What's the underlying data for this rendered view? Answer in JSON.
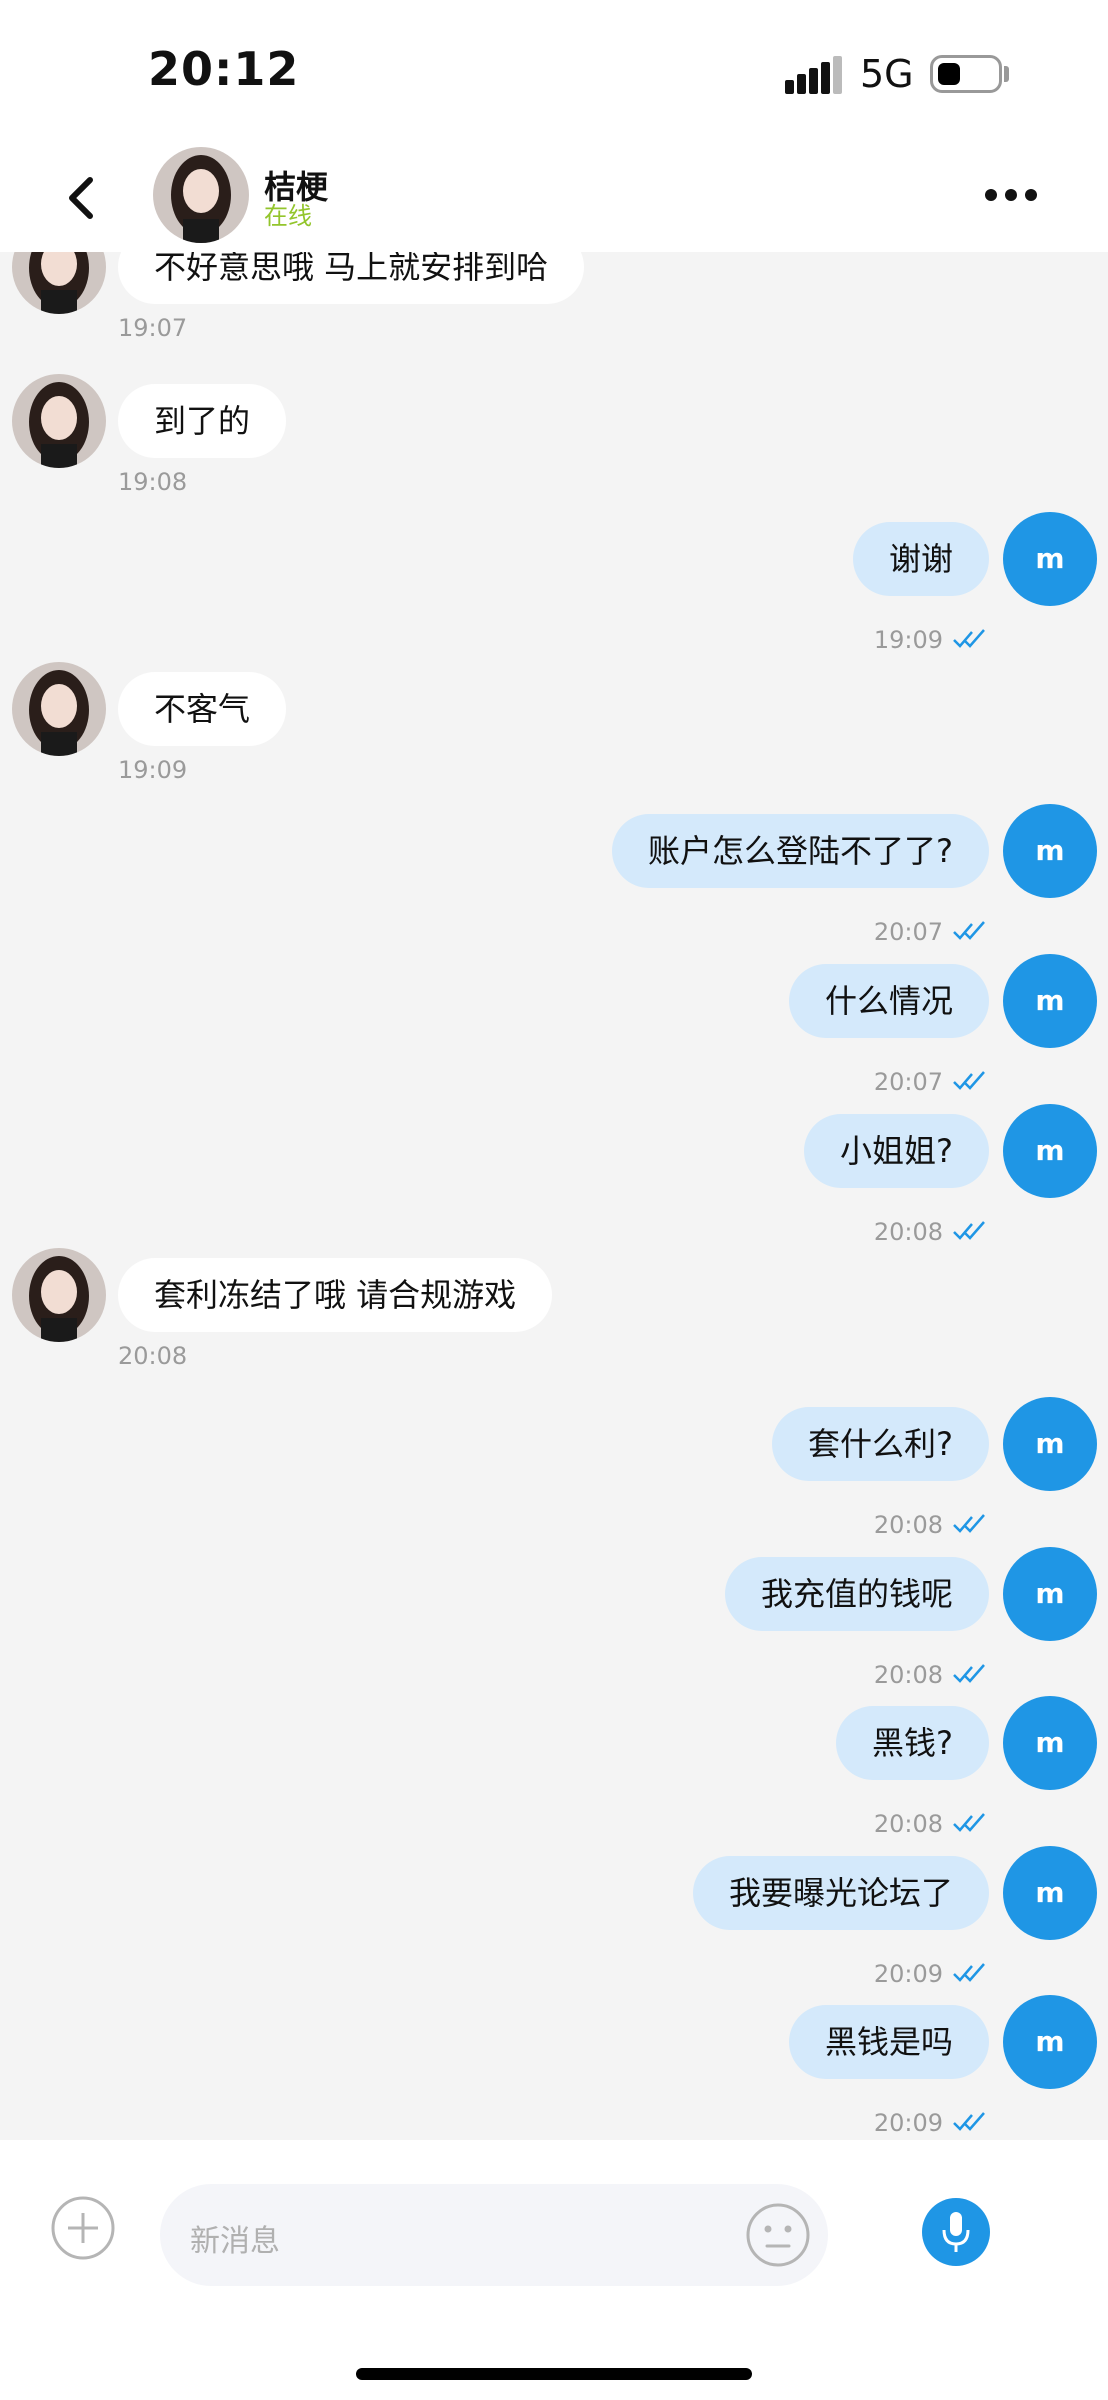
{
  "status_bar": {
    "time": "20:12",
    "network": "5G"
  },
  "header": {
    "name": "桔梗",
    "status": "在线"
  },
  "icons": {
    "back": "chevron-left-icon",
    "more": "more-horizontal-icon",
    "plus": "plus-circle-icon",
    "emoji": "emoji-icon",
    "mic": "microphone-icon",
    "read": "double-check-icon"
  },
  "colors": {
    "accent": "#1f96e5",
    "sent_bubble": "#d4e9fb",
    "online": "#93c52c"
  },
  "messages": [
    {
      "side": "left",
      "text": "不好意思哦  马上就安排到哈",
      "time": "19:07"
    },
    {
      "side": "left",
      "text": "到了的",
      "time": "19:08"
    },
    {
      "side": "right",
      "text": "谢谢",
      "time": "19:09",
      "avatar": "m"
    },
    {
      "side": "left",
      "text": "不客气",
      "time": "19:09"
    },
    {
      "side": "right",
      "text": "账户怎么登陆不了了?",
      "time": "20:07",
      "avatar": "m"
    },
    {
      "side": "right",
      "text": "什么情况",
      "time": "20:07",
      "avatar": "m"
    },
    {
      "side": "right",
      "text": "小姐姐?",
      "time": "20:08",
      "avatar": "m"
    },
    {
      "side": "left",
      "text": "套利冻结了哦  请合规游戏",
      "time": "20:08"
    },
    {
      "side": "right",
      "text": "套什么利?",
      "time": "20:08",
      "avatar": "m"
    },
    {
      "side": "right",
      "text": "我充值的钱呢",
      "time": "20:08",
      "avatar": "m"
    },
    {
      "side": "right",
      "text": "黑钱?",
      "time": "20:08",
      "avatar": "m"
    },
    {
      "side": "right",
      "text": "我要曝光论坛了",
      "time": "20:09",
      "avatar": "m"
    },
    {
      "side": "right",
      "text": "黑钱是吗",
      "time": "20:09",
      "avatar": "m"
    }
  ],
  "input": {
    "placeholder": "新消息"
  }
}
